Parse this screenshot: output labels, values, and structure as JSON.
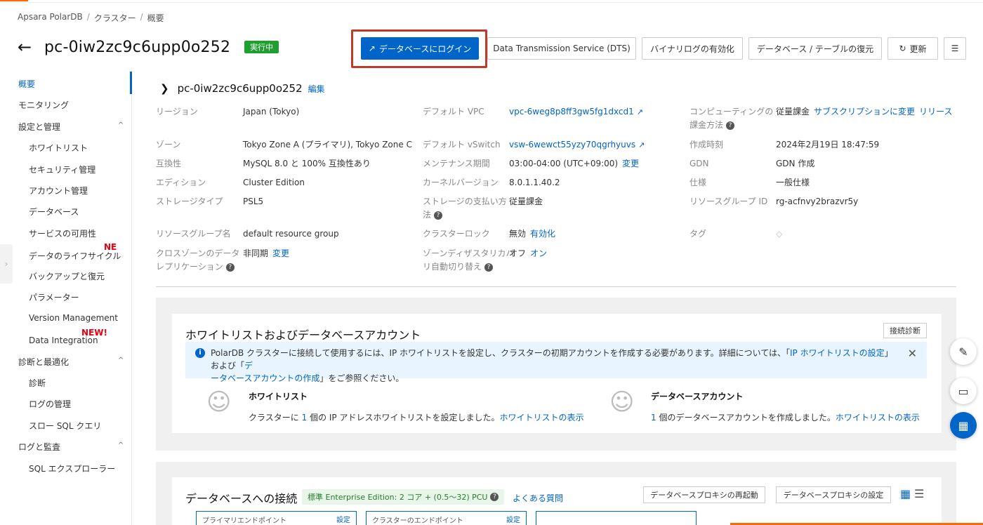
{
  "breadcrumb": [
    "Apsara PolarDB",
    "クラスター",
    "概要"
  ],
  "header": {
    "title": "pc-0iw2zc9c6upp0o252",
    "status": "実行中"
  },
  "toolbar": {
    "login_db": "データベースにログイン",
    "dts": "Data Transmission Service (DTS)",
    "binlog": "バイナリログの有効化",
    "restore": "データベース / テーブルの復元",
    "refresh": "更新"
  },
  "sidebar": {
    "overview": "概要",
    "monitoring": "モニタリング",
    "settings_group": "設定と管理",
    "whitelist": "ホワイトリスト",
    "security": "セキュリティ管理",
    "accounts": "アカウント管理",
    "databases": "データベース",
    "availability": "サービスの可用性",
    "lifecycle": "データのライフサイクル",
    "lifecycle_badge": "NE",
    "backup": "バックアップと復元",
    "parameters": "パラメーター",
    "version": "Version Management",
    "integration": "Data Integration",
    "integration_badge": "NEW!",
    "diag_group": "診断と最適化",
    "diagnosis": "診断",
    "logs": "ログの管理",
    "slow_sql": "スロー SQL クエリ",
    "audit_group": "ログと監査",
    "sql_explorer": "SQL エクスプローラー"
  },
  "info": {
    "title": "pc-0iw2zc9c6upp0o252",
    "edit": "編集",
    "region_label": "リージョン",
    "region": "Japan (Tokyo)",
    "zone_label": "ゾーン",
    "zone": "Tokyo Zone A (プライマリ), Tokyo Zone C",
    "compat_label": "互換性",
    "compat": "MySQL 8.0 と 100% 互換性あり",
    "edition_label": "エディション",
    "edition": "Cluster Edition",
    "storage_label": "ストレージタイプ",
    "storage": "PSL5",
    "rg_name_label": "リソースグループ名",
    "rg_name": "default resource group",
    "crosszone_label_1": "クロスゾーンのデータ",
    "crosszone_label_2": "レプリケーション",
    "crosszone": "非同期",
    "crosszone_change": "変更",
    "vpc_label": "デフォルト VPC",
    "vpc": "vpc-6weg8p8ff3gw5fg1dxcd1",
    "vswitch_label": "デフォルト vSwitch",
    "vswitch": "vsw-6wewct55yzy70qgrhyuvs",
    "maint_label": "メンテナンス期間",
    "maint": "03:00-04:00 (UTC+09:00)",
    "maint_change": "変更",
    "kernel_label": "カーネルバージョン",
    "kernel": "8.0.1.1.40.2",
    "storage_pay_label_1": "ストレージの支払い方",
    "storage_pay_label_2": "法",
    "storage_pay": "従量課金",
    "lock_label": "クラスターロック",
    "lock": "無効",
    "lock_enable": "有効化",
    "failover_label_1": "ゾーンディザスタリカバ",
    "failover_label_2": "リ自動切り替え",
    "failover": "オフ",
    "failover_on": "オン",
    "compute_label_1": "コンピューティングの",
    "compute_label_2": "課金方法",
    "compute": "従量課金",
    "compute_sub": "サブスクリプションに変更",
    "compute_release": "リリース",
    "created_label": "作成時刻",
    "created": "2024年2月19日 18:47:59",
    "gdn_label": "GDN",
    "gdn": "GDN 作成",
    "spec_label": "仕様",
    "spec": "一般仕様",
    "rg_id_label": "リソースグループ ID",
    "rg_id": "rg-acfnvy2brazvr5y",
    "tag_label": "タグ"
  },
  "whitelist_panel": {
    "title": "ホワイトリストおよびデータベースアカウント",
    "diag_button": "接続診断",
    "notice_1": "PolarDB クラスターに接続して使用するには、IP ホワイトリストを設定し、クラスターの初期アカウントを作成する必要があります。詳細については、「",
    "notice_link1": "IP ホワイトリストの設定",
    "notice_2": "」および「",
    "notice_link2a": "デ",
    "notice_link2b": "ータベースアカウントの作成",
    "notice_3": "」をご参照ください。",
    "wl_title": "ホワイトリスト",
    "wl_text_1": "クラスターに",
    "wl_count": "1",
    "wl_text_2": "個の IP アドレスホワイトリストを設定しました。",
    "wl_link": "ホワイトリストの表示",
    "acc_title": "データベースアカウント",
    "acc_count": "1",
    "acc_text": "個のデータベースアカウントを作成しました。",
    "acc_link": "ホワイトリストの表示"
  },
  "connection_panel": {
    "title": "データベースへの接続",
    "spec": "標準 Enterprise Edition: 2 コア + (0.5〜32) PCU",
    "faq": "よくある質問",
    "restart_proxy": "データベースプロキシの再起動",
    "proxy_settings": "データベースプロキシの設定",
    "primary_ep": "プライマリエンドポイント",
    "cluster_ep": "クラスターのエンドポイント",
    "set": "設定"
  },
  "colors": {
    "primary": "#0064c8",
    "success": "#1f9f2f",
    "highlight": "#c0392b",
    "accent": "#ff6a00"
  }
}
